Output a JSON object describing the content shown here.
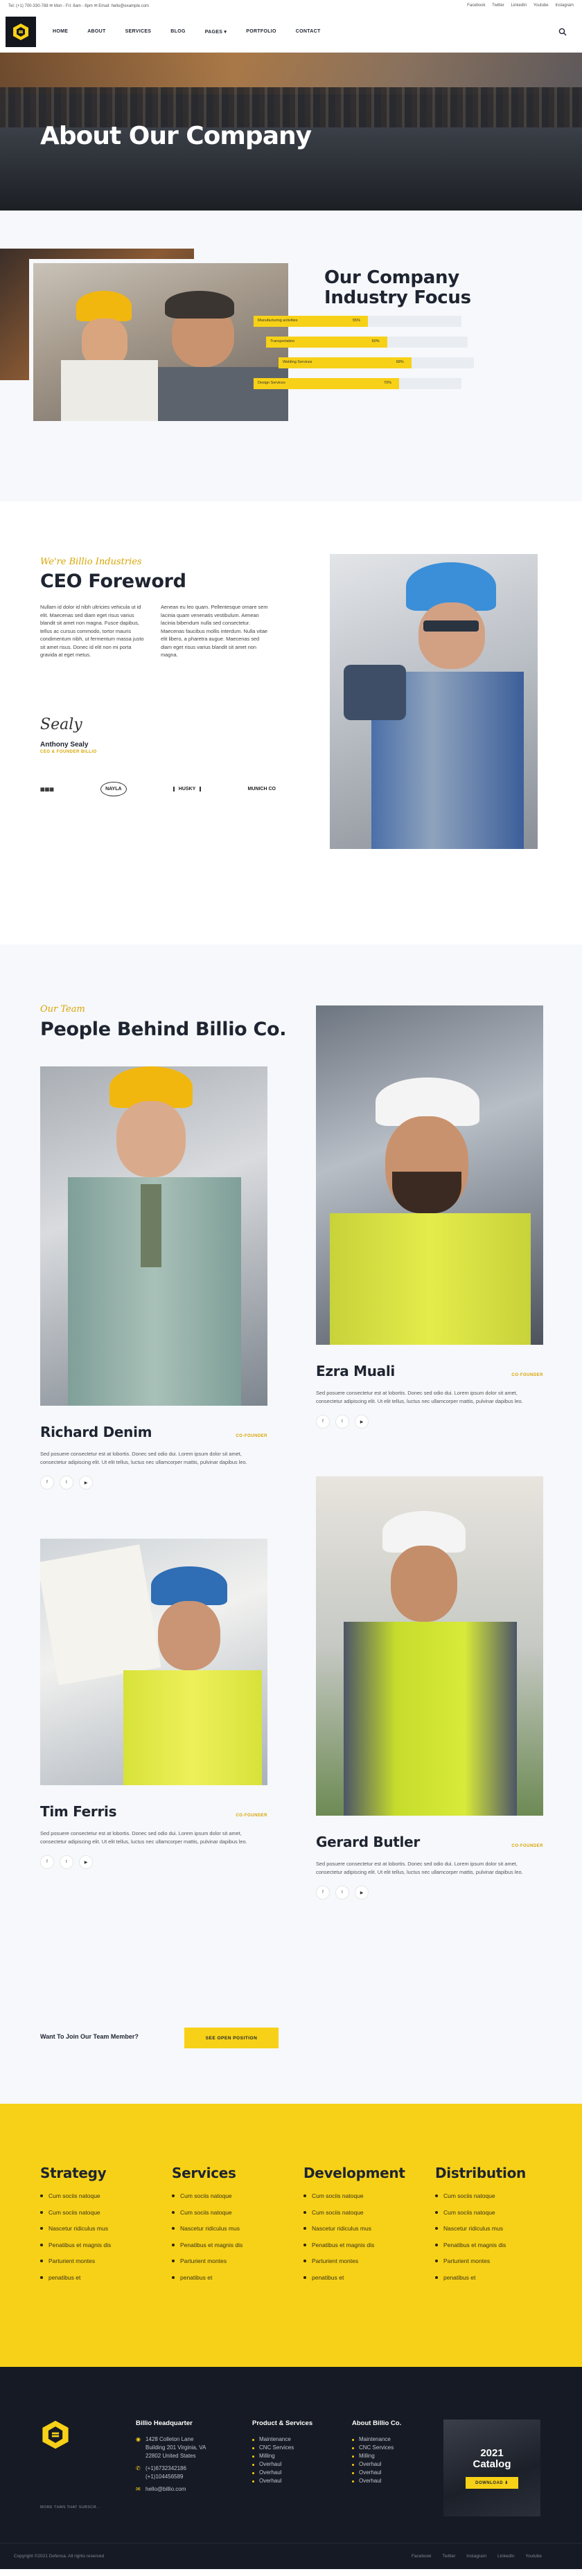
{
  "topbar": {
    "left": "Tel: (+1) 700-330-788   ✉  Mon - Fri: 8am - 8pm   ✉  Email: hello@example.com",
    "links": [
      "Facebook",
      "Twitter",
      "LinkedIn",
      "Youtube",
      "Instagram"
    ]
  },
  "nav": {
    "items": [
      "HOME",
      "ABOUT",
      "SERVICES",
      "BLOG",
      "PAGES ▾",
      "PORTFOLIO",
      "CONTACT"
    ]
  },
  "hero": {
    "title": "About Our Company"
  },
  "focus": {
    "title_line1": "Our Company",
    "title_line2": "Industry Focus",
    "bars": [
      {
        "label": "Manufacturing activities",
        "value": 55
      },
      {
        "label": "Transportation",
        "value": 60
      },
      {
        "label": "Welding Services",
        "value": 68
      },
      {
        "label": "Design Services",
        "value": 70
      }
    ]
  },
  "ceo": {
    "kicker": "We're Billio Industries",
    "title": "CEO Foreword",
    "col1": "Nullam id dolor id nibh ultricies vehicula ut id elit. Maecenas sed diam eget risus varius blandit sit amet non magna. Fusce dapibus, tellus ac cursus commodo, tortor mauris condimentum nibh, ut fermentum massa justo sit amet risus. Donec id elit non mi porta gravida at eget metus.",
    "col2": "Aenean eu leo quam. Pellentesque ornare sem lacinia quam venenatis vestibulum. Aenean lacinia bibendum nulla sed consectetur. Maecenas faucibus mollis interdum. Nulla vitae elit libero, a pharetra augue. Maecenas sed diam eget risus varius blandit sit amet non magna.",
    "signature": "Sealy",
    "name": "Anthony Sealy",
    "role": "CEO & FOUNDER BILLIO",
    "logos": [
      "▦▦▦",
      "NAYLA",
      "HUSKY",
      "MUNICH CO"
    ]
  },
  "team": {
    "kicker": "Our Team",
    "title": "People Behind Billio Co.",
    "desc": "Sed posuere consectetur est at lobortis. Donec sed odio dui. Lorem ipsum dolor sit amet, consectetur adipiscing elit. Ut elit tellus, luctus nec ullamcorper mattis, pulvinar dapibus leo.",
    "socials": [
      "f",
      "t",
      "▶"
    ],
    "members": [
      {
        "name": "Richard Denim",
        "role": "CO-FOUNDER"
      },
      {
        "name": "Ezra Muali",
        "role": "CO-FOUNDER"
      },
      {
        "name": "Tim Ferris",
        "role": "CO-FOUNDER"
      },
      {
        "name": "Gerard Butler",
        "role": "CO-FOUNDER"
      }
    ],
    "join_text": "Want To Join Our Team Member?",
    "join_button": "SEE OPEN POSITION"
  },
  "services": {
    "columns": [
      {
        "title": "Strategy",
        "items": [
          "Cum sociis natoque",
          "Cum sociis natoque",
          "Nascetur ridiculus mus",
          "Penatibus et magnis dis",
          "Parturient montes",
          "penatibus et"
        ]
      },
      {
        "title": "Services",
        "items": [
          "Cum sociis natoque",
          "Cum sociis natoque",
          "Nascetur ridiculus mus",
          "Penatibus et magnis dis",
          "Parturient montes",
          "penatibus et"
        ]
      },
      {
        "title": "Development",
        "items": [
          "Cum sociis natoque",
          "Cum sociis natoque",
          "Nascetur ridiculus mus",
          "Penatibus et magnis dis",
          "Parturient montes",
          "penatibus et"
        ]
      },
      {
        "title": "Distribution",
        "items": [
          "Cum sociis natoque",
          "Cum sociis natoque",
          "Nascetur ridiculus mus",
          "Penatibus et magnis dis",
          "Parturient montes",
          "penatibus et"
        ]
      }
    ]
  },
  "footer": {
    "tagline": "MORE THAN THAT SUBSCR...",
    "hq_title": "Billio Headquarter",
    "hq_address1": "1428 Colleton Lane",
    "hq_address2": "Building 201 Virginia, VA",
    "hq_address3": "22802 United States",
    "hq_phone1": "(+1)6732342186",
    "hq_phone2": "(+1)104456589",
    "hq_email": "hello@billio.com",
    "products_title": "Product & Services",
    "products": [
      "Maintenance",
      "CNC Services",
      "Milling",
      "Overhaul",
      "Overhaul",
      "Overhaul"
    ],
    "about_title": "About Billio Co.",
    "about": [
      "Maintenance",
      "CNC Services",
      "Milling",
      "Overhaul",
      "Overhaul",
      "Overhaul"
    ],
    "catalog_year": "2021",
    "catalog_title": "Catalog",
    "catalog_button": "DOWNLOAD ⬇",
    "copyright": "Copyright ©2021 Defensa. All rights reserved",
    "links": [
      "Facebook",
      "Twitter",
      "Instagram",
      "LinkedIn",
      "Youtube"
    ]
  },
  "colors": {
    "accent": "#f7d117",
    "dark": "#161a24",
    "light_bg": "#f6f8fb"
  }
}
